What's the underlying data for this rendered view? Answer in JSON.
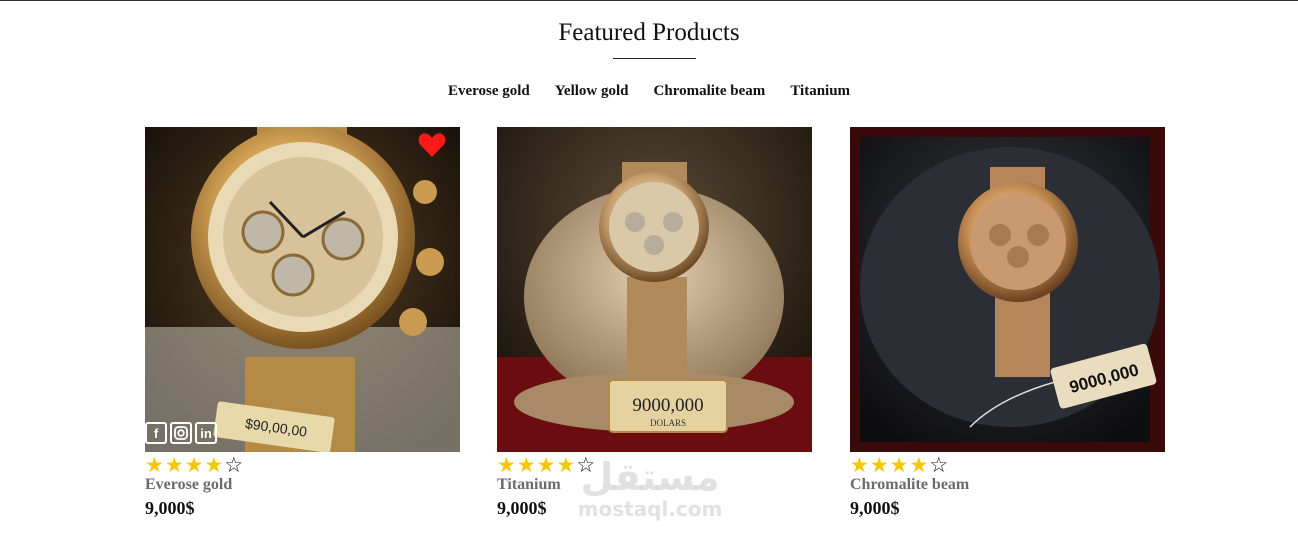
{
  "section": {
    "title": "Featured Products"
  },
  "filters": [
    "Everose gold",
    "Yellow gold",
    "Chromalite beam",
    "Titanium"
  ],
  "products": [
    {
      "name": "Everose gold",
      "price": "9,000$",
      "rating": 4,
      "rating_max": 5,
      "tag_text": "$90,00,00",
      "favorite": true,
      "socials": [
        "f",
        "ig",
        "in"
      ]
    },
    {
      "name": "Titanium",
      "price": "9,000$",
      "rating": 4,
      "rating_max": 5,
      "tag_text": "9000,000",
      "tag_sub": "DOLARS"
    },
    {
      "name": "Chromalite beam",
      "price": "9,000$",
      "rating": 4,
      "rating_max": 5,
      "tag_text": "9000,000"
    }
  ],
  "watermark": {
    "arabic": "مستقل",
    "latin": "mostaql.com"
  },
  "colors": {
    "star": "#f6c700",
    "heart": "#ff1a1a",
    "name": "#6b6b6b"
  }
}
